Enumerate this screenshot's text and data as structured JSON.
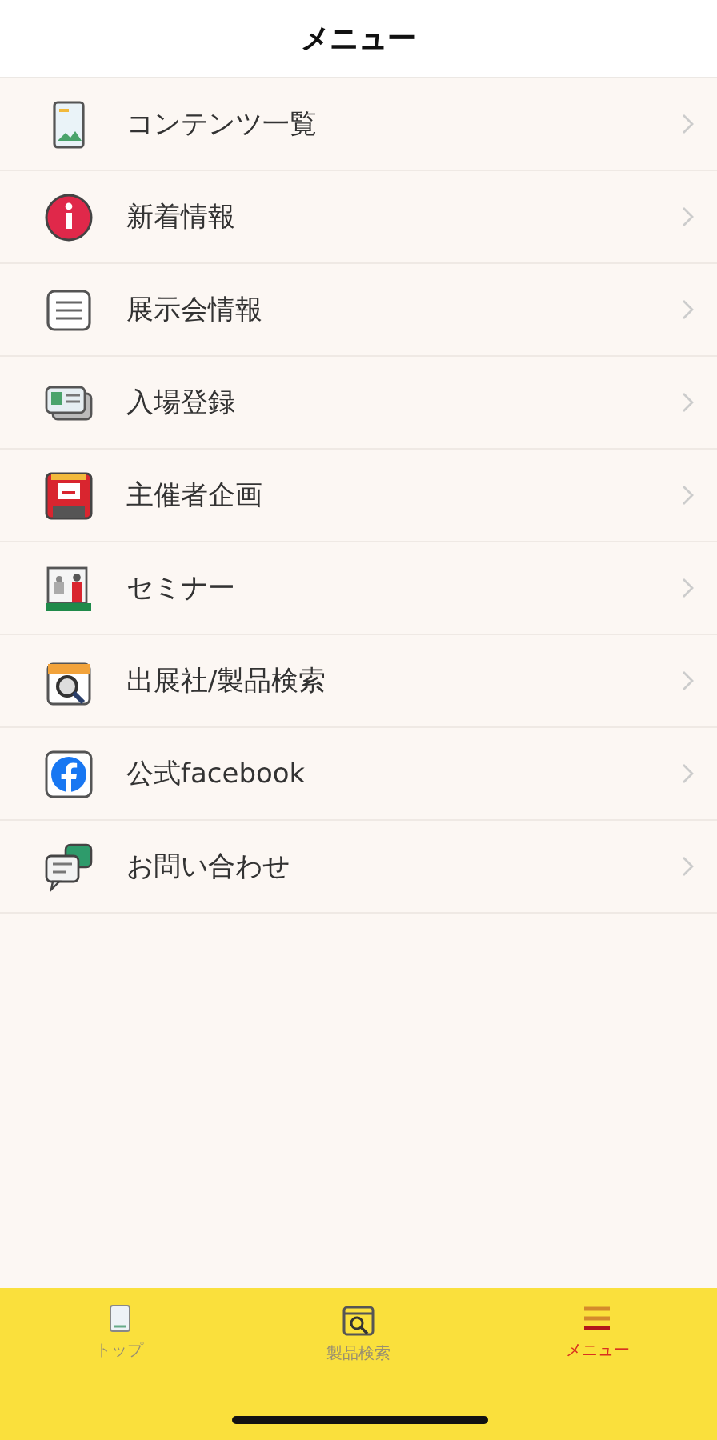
{
  "header": {
    "title": "メニュー"
  },
  "menu": [
    {
      "kind": "contents",
      "label": "コンテンツ一覧"
    },
    {
      "kind": "info",
      "label": "新着情報"
    },
    {
      "kind": "document",
      "label": "展示会情報"
    },
    {
      "kind": "card",
      "label": "入場登録"
    },
    {
      "kind": "stage",
      "label": "主催者企画"
    },
    {
      "kind": "seminar",
      "label": "セミナー"
    },
    {
      "kind": "search",
      "label": "出展社/製品検索"
    },
    {
      "kind": "facebook",
      "label": "公式facebook"
    },
    {
      "kind": "chat",
      "label": "お問い合わせ"
    }
  ],
  "tab_bar": [
    {
      "kind": "top",
      "label": "トップ",
      "selected": false
    },
    {
      "kind": "search",
      "label": "製品検索",
      "selected": false
    },
    {
      "kind": "menu",
      "label": "メニュー",
      "selected": true
    }
  ]
}
